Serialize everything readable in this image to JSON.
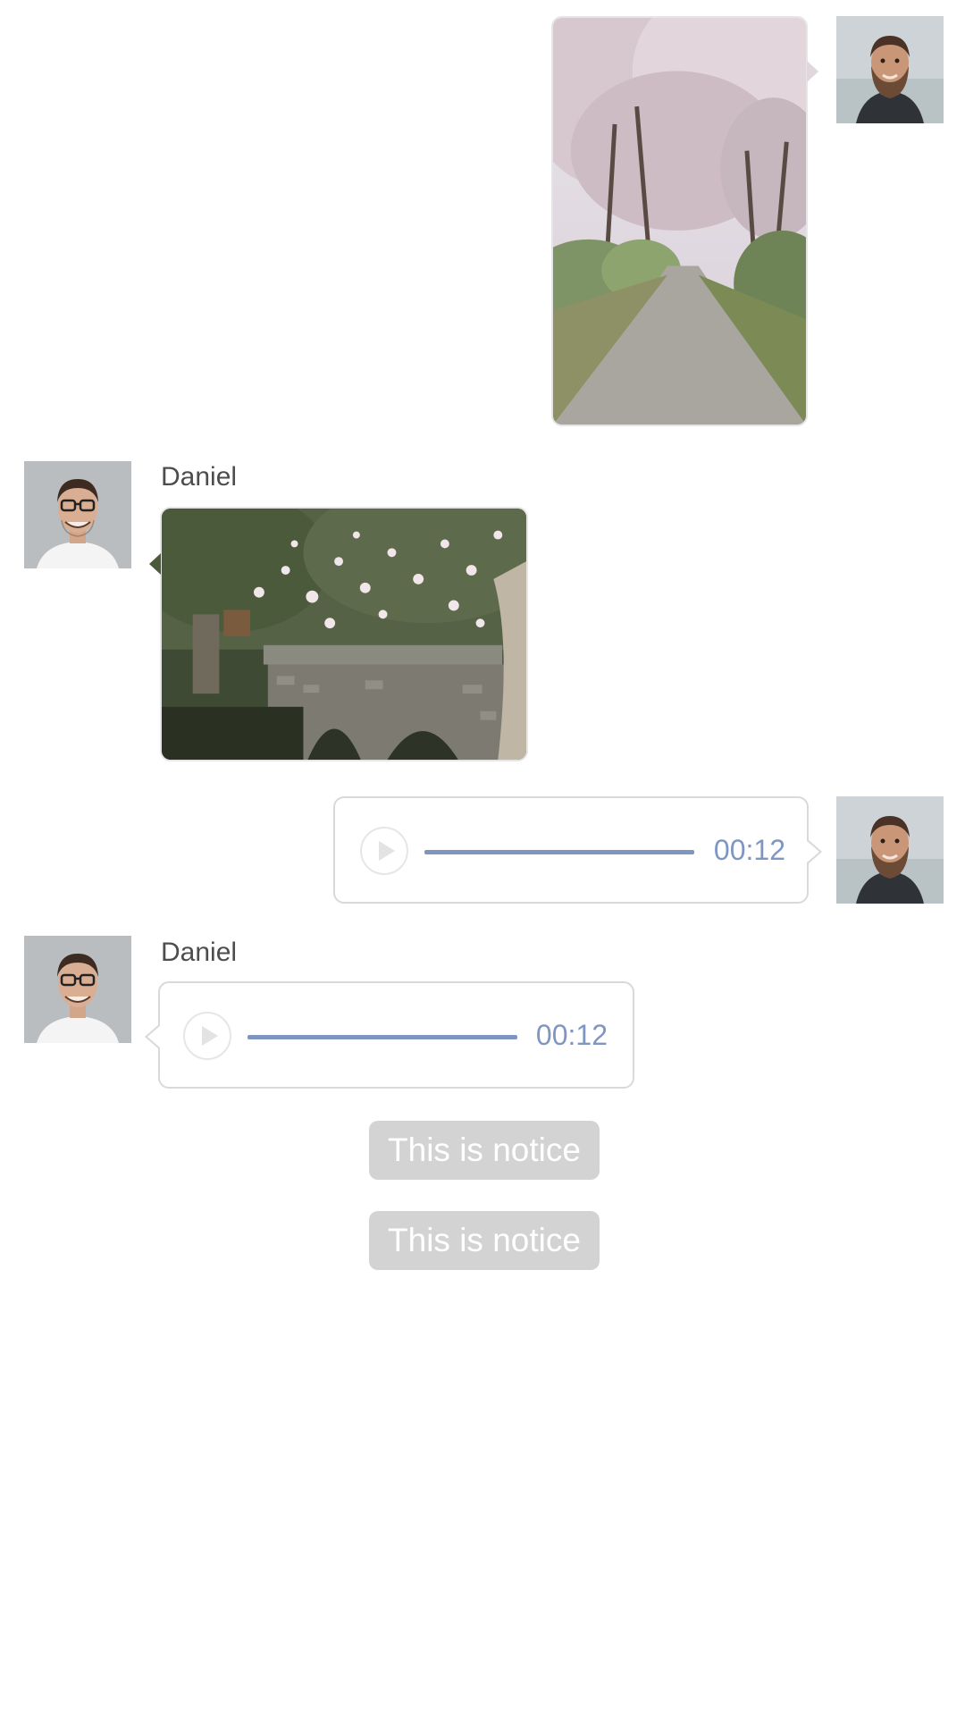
{
  "messages": [
    {
      "type": "image",
      "direction": "outgoing",
      "image": "cherry-blossom-path-photo",
      "avatar": "bearded-man-avatar"
    },
    {
      "type": "image",
      "direction": "incoming",
      "sender": "Daniel",
      "image": "stone-bridge-blossom-photo",
      "avatar": "man-with-glasses-avatar"
    },
    {
      "type": "voice",
      "direction": "outgoing",
      "duration": "00:12",
      "icon": "play-icon",
      "avatar": "bearded-man-avatar"
    },
    {
      "type": "voice",
      "direction": "incoming",
      "sender": "Daniel",
      "duration": "00:12",
      "icon": "play-icon",
      "avatar": "man-with-glasses-avatar"
    }
  ],
  "notices": [
    "This is notice",
    "This is notice"
  ],
  "colors": {
    "voice_accent": "#7f96c2",
    "notice_bg": "#d3d3d3",
    "bubble_border": "#d9d9d9"
  }
}
